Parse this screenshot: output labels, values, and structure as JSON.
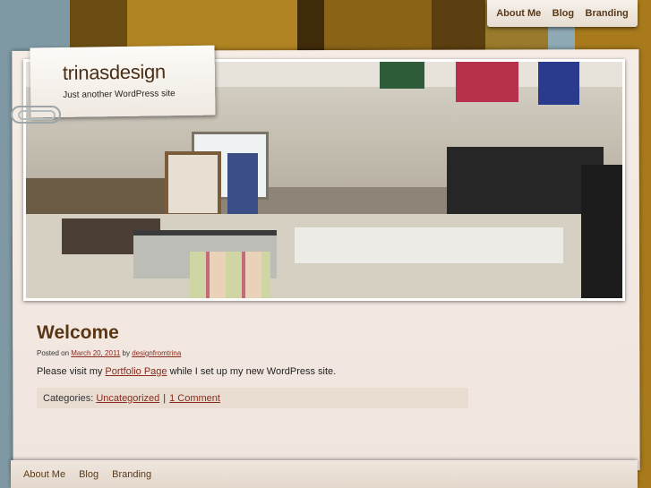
{
  "top_nav": {
    "items": [
      {
        "label": "About Me"
      },
      {
        "label": "Blog"
      },
      {
        "label": "Branding"
      }
    ]
  },
  "header": {
    "site_title": "trinasdesign",
    "site_description": "Just another WordPress site",
    "photo_icon": "studio-photo"
  },
  "post": {
    "title": "Welcome",
    "meta_prefix": "Posted on",
    "date": "March 20, 2011",
    "meta_by": "by",
    "author": "designfromtrina",
    "body_prefix": "Please visit my",
    "body_link": "Portfolio Page",
    "body_suffix": "while I set up my new WordPress site.",
    "categories_label": "Categories:",
    "category": "Uncategorized",
    "separator": "|",
    "comments": "1 Comment"
  },
  "bottom_nav": {
    "items": [
      {
        "label": "About Me"
      },
      {
        "label": "Blog"
      },
      {
        "label": "Branding"
      }
    ]
  },
  "colors": {
    "accent_link": "#8a2a1a",
    "title_brown": "#5a3614",
    "paper": "#f5ede6"
  }
}
